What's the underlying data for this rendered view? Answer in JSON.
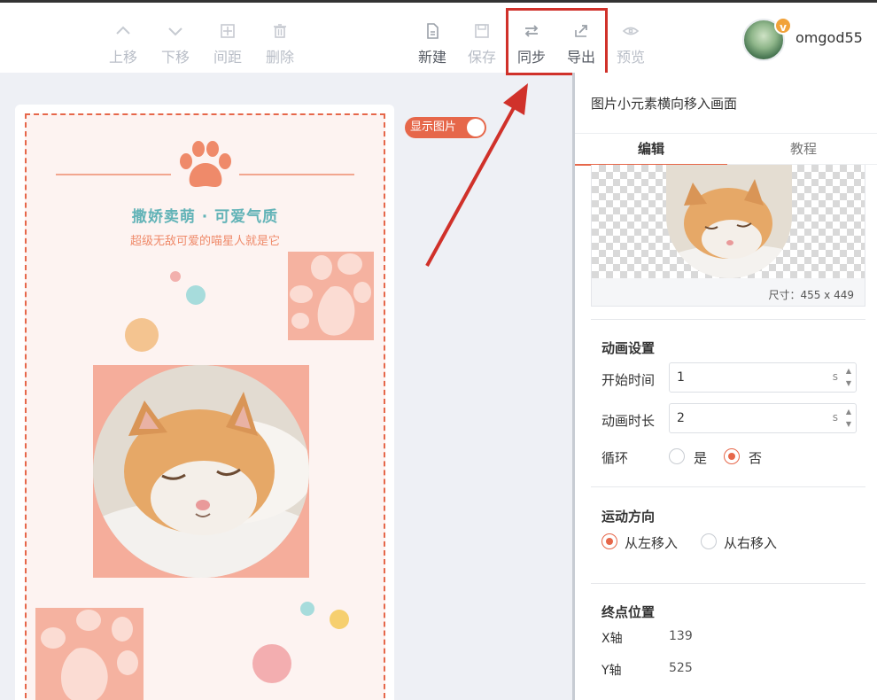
{
  "toolbar": {
    "items": [
      {
        "label": "上移",
        "icon": "chevron-up-icon",
        "enabled": false
      },
      {
        "label": "下移",
        "icon": "chevron-down-icon",
        "enabled": false
      },
      {
        "label": "间距",
        "icon": "spacing-icon",
        "enabled": false
      },
      {
        "label": "删除",
        "icon": "trash-icon",
        "enabled": false
      },
      {
        "label": "新建",
        "icon": "new-file-icon",
        "enabled": true
      },
      {
        "label": "保存",
        "icon": "save-icon",
        "enabled": false
      },
      {
        "label": "同步",
        "icon": "sync-icon",
        "enabled": true
      },
      {
        "label": "导出",
        "icon": "export-icon",
        "enabled": true
      },
      {
        "label": "预览",
        "icon": "eye-icon",
        "enabled": false
      }
    ],
    "highlight_color": "#d0312a"
  },
  "user": {
    "name": "omgod55",
    "badge": "v"
  },
  "canvas": {
    "toggle_label": "显示图片",
    "poster": {
      "title": "撒娇卖萌 · 可爱气质",
      "subtitle": "超级无敌可爱的喵星人就是它"
    }
  },
  "panel": {
    "title": "图片小元素横向移入画面",
    "tabs": [
      "编辑",
      "教程"
    ],
    "active_tab": "编辑",
    "size_label": "尺寸：455 x 449",
    "animation": {
      "heading": "动画设置",
      "start_label": "开始时间",
      "start_value": "1",
      "duration_label": "动画时长",
      "duration_value": "2",
      "unit": "s",
      "loop_label": "循环",
      "loop_yes": "是",
      "loop_no": "否",
      "loop_selected": "否"
    },
    "direction": {
      "heading": "运动方向",
      "from_left": "从左移入",
      "from_right": "从右移入",
      "selected": "从左移入"
    },
    "end_position": {
      "heading": "终点位置",
      "x_label": "X轴",
      "x_value": "139",
      "y_label": "Y轴",
      "y_value": "525"
    }
  },
  "colors": {
    "accent": "#e6674a",
    "title_teal": "#62b3b7",
    "poster_bg": "#fdf3f1"
  }
}
